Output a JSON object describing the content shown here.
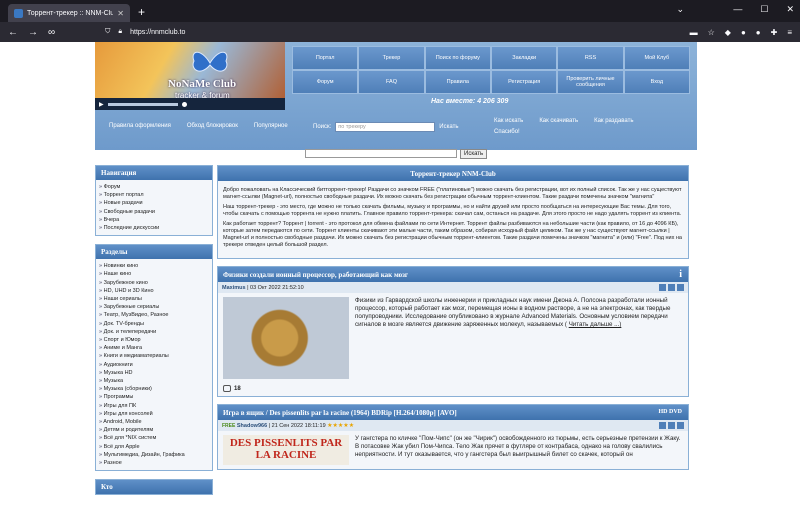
{
  "browser": {
    "tab_title": "Торрент-трекер :: NNM-Club",
    "tab_close": "✕",
    "new_tab": "+",
    "url": "https://nnmclub.to",
    "win_min": "—",
    "win_max": "☐",
    "win_close": "✕",
    "chevron": "⌄"
  },
  "header": {
    "logo_line1": "NoNaMe Club",
    "logo_line2": "tracker & forum",
    "online_text": "Нас вместе: 4 206 309",
    "menu": [
      "Портал",
      "Трекер",
      "Поиск по форуму",
      "Закладки",
      "RSS",
      "Мой Клуб",
      "Форум",
      "FAQ",
      "Правила",
      "Регистрация",
      "Проверить личные сообщения",
      "Вход"
    ],
    "subnav": [
      "Правила оформления",
      "Обход блокировок",
      "Популярное"
    ],
    "search_label": "Поиск:",
    "search_placeholder": "по трекеру",
    "search_button": "Искать",
    "sublinks": [
      "Как искать",
      "Как скачивать",
      "Как раздавать",
      "Спасибо!"
    ]
  },
  "global_search": {
    "button": "Искать"
  },
  "sidebar": {
    "nav_title": "Навигация",
    "nav_items": [
      "Форум",
      "Торрент портал",
      "Новые раздачи",
      "Свободные раздачи",
      "Вчера",
      "Последние дискуссии"
    ],
    "sections_title": "Разделы",
    "sections": [
      "Новинки кино",
      "Наше кино",
      "Зарубежное кино",
      "HD, UHD и 3D Кино",
      "Наши сериалы",
      "Зарубежные сериалы",
      "Театр, МузВидео, Разное",
      "Док. TV-бренды",
      "Док. и телепередачи",
      "Спорт и Юмор",
      "Аниме и Манга",
      "Книги и медиаматериалы",
      "Аудиокниги",
      "Музыка HD",
      "Музыка",
      "Музыка (сборники)",
      "Программы",
      "Игры для ПК",
      "Игры для консолей",
      "Android, Mobile",
      "Детям и родителям",
      "Всё для *NIX систем",
      "Всё для Apple",
      "Мультимедиа, Дизайн, Графика",
      "Разное"
    ],
    "who_title": "Кто"
  },
  "intro": {
    "title": "Торрент-трекер NNM-Club",
    "p1": "Добро пожаловать на Классический битторрент-трекер! Раздачи со значком FREE (\"платиновые\") можно скачать без регистрации, вот их полный список. Так же у нас существуют магнет-ссылки (Magnet-url), полностью свободные раздачи. Их можно скачать без регистрации обычным торрент-клиентом. Такие раздачи помечены значком \"магнита\"",
    "p2": "Наш торрент-трекер - это место, где можно не только скачать фильмы, музыку и программы, но и найти друзей или просто пообщаться на интересующие Вас темы. Для того, чтобы скачать с помощью торрента не нужно платить. Главное правило торрент-трекера: скачал сам, останься на раздаче. Для этого просто не надо удалять торрент из клиента.",
    "p3": "Как работает торрент? Торрент | torrent - это протокол для обмена файлами по сети Интернет. Торрент файлы разбиваются на небольшие части (как правило, от 16 до 4096 КБ), которые затем передаются по сети. Торрент клиенты скачивают эти малые части, таким образом, собирая исходный файл целиком. Так же у нас существуют магнет-ссылки | Magnet-url и полностью свободные раздачи. Их можно скачать без регистрации обычным торрент-клиентом. Такие раздачи помечены значком \"магнита\" и (или) \"Free\". Под них на трекере отведен целый большой раздел."
  },
  "posts": [
    {
      "title": "Физики создали ионный процессор, работающий как мозг",
      "author": "Maximus",
      "date": "| 03 Окт 2022 21:52:10",
      "text": "Физики из Гарвардской школы инженерии и прикладных наук имени Джона А. Полсона разработали ионный процессор, который работает как мозг, перемещая ионы в водном растворе, а не на электронах, как твердые полупроводники. Исследование опубликовано в журнале Advanced Materials. Основным условием передачи сигналов в мозге является движение заряженных молекул, называемых (",
      "more": "Читать дальше ...)",
      "comments": "18"
    },
    {
      "title": "Игра в ящик / Des pissenlits par la racine (1964) BDRip [H.264/1080p] [AVO]",
      "free": "FREE",
      "author": "Shadow966",
      "date": "| 21 Сен 2022 18:11:19",
      "stars": "★★★★★",
      "img_text": "DES PISSENLITS PAR LA RACINE",
      "text": "У гангстера по кличке \"Пом-Чипс\" (он же \"Чирик\") освобожденного из тюрьмы, есть серьезные претензии к Жаку. В потасовке Жак убил Пом-Чипса. Тело Жак прячет в футляре от контрабаса, однако на голову свалились неприятности. И тут оказывается, что у гангстера был выигрышный билет со скачек, который он"
    }
  ]
}
